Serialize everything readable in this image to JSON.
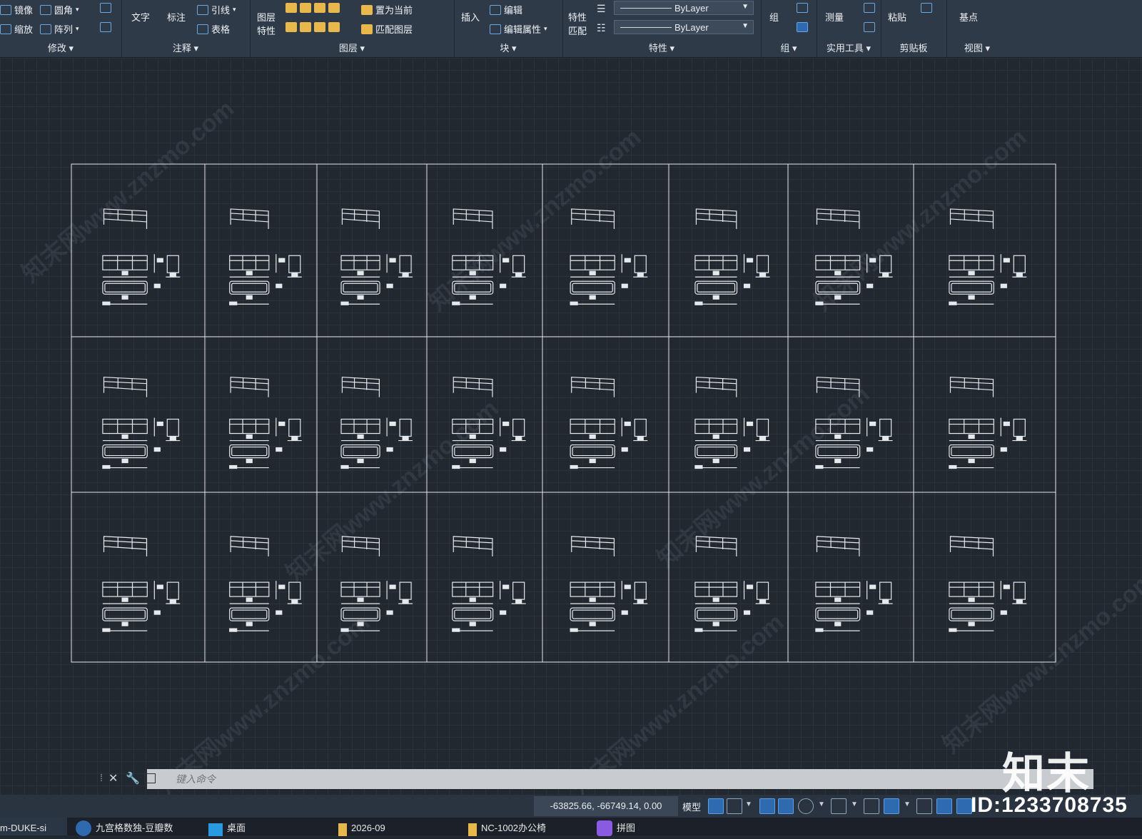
{
  "ribbon": {
    "modify": {
      "title": "修改",
      "mirror": "镜像",
      "fillet": "圆角",
      "scale": "缩放",
      "array": "阵列"
    },
    "annotation": {
      "title": "注释",
      "text": "文字",
      "dimension": "标注",
      "leader": "引线",
      "table": "表格"
    },
    "layers": {
      "title": "图层",
      "layer_props_1": "图层",
      "layer_props_2": "特性",
      "set_current": "置为当前",
      "match_layer": "匹配图层"
    },
    "block": {
      "title": "块",
      "insert": "插入",
      "edit": "编辑",
      "edit_attributes": "编辑属性"
    },
    "properties": {
      "title": "特性",
      "match_1": "特性",
      "match_2": "匹配",
      "color": "ByLayer",
      "linetype": "ByLayer"
    },
    "groups": {
      "title": "组",
      "group": "组"
    },
    "utilities": {
      "title": "实用工具",
      "measure": "测量"
    },
    "clipboard": {
      "title": "剪贴板",
      "paste": "粘贴"
    },
    "view": {
      "title": "视图",
      "base": "基点"
    }
  },
  "drawing": {
    "columns": 8,
    "rows": 3
  },
  "command_line": {
    "placeholder": "键入命令"
  },
  "status_bar": {
    "coordinates": "-63825.66, -66749.14, 0.00",
    "model": "模型"
  },
  "taskbar": {
    "items": [
      "m-DUKE-si",
      "九宫格数独-豆瓣数",
      "桌面",
      "2026-09",
      "NC-1002办公椅",
      "拼图"
    ]
  },
  "watermark": {
    "site": "知末网www.znzmo.com",
    "logo": "知末",
    "id": "ID:1233708735"
  },
  "colors": {
    "accent": "#2d6ab0",
    "lines": "#e6e9ec"
  }
}
